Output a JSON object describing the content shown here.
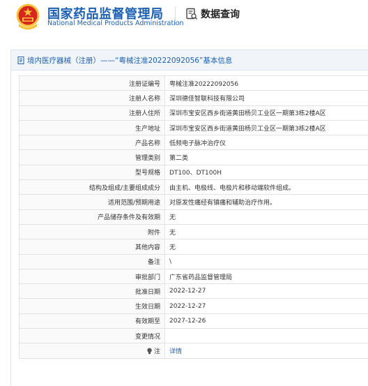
{
  "header": {
    "org_name_cn": "国家药品监督管理局",
    "org_name_en": "National Medical Products Administration",
    "query_label": "数据查询",
    "colors": {
      "brand": "#1a5fb4",
      "emblem_red": "#d7261e",
      "emblem_gold": "#f6c33a"
    }
  },
  "panel": {
    "title": "境内医疗器械（注册）——“粤械注准20222092056”基本信息"
  },
  "rows": [
    {
      "key": "注册证编号",
      "value": "粤械注准20222092056"
    },
    {
      "key": "注册人名称",
      "value": "深圳德佳智联科技有限公司"
    },
    {
      "key": "注册人住所",
      "value": "深圳市宝安区西乡街道黄田杨贝工业区一期第3栋2楼A区"
    },
    {
      "key": "生产地址",
      "value": "深圳市宝安区西乡街道黄田杨贝工业区一期第3栋2楼A区"
    },
    {
      "key": "产品名称",
      "value": "低频电子脉冲治疗仪"
    },
    {
      "key": "管理类别",
      "value": "第二类"
    },
    {
      "key": "型号规格",
      "value": "DT100、DT100H"
    },
    {
      "key": "结构及组成/主要组成成分",
      "value": "由主机、电极线、电极片和移动端软件组成。"
    },
    {
      "key": "适用范围/预期用途",
      "value": "对原发性痛经有镇痛和辅助治疗作用。"
    },
    {
      "key": "产品储存条件及有效期",
      "value": "无"
    },
    {
      "key": "附件",
      "value": "无"
    },
    {
      "key": "其他内容",
      "value": "无"
    },
    {
      "key": "备注",
      "value": "\\"
    },
    {
      "key": "审批部门",
      "value": "广东省药品监督管理局"
    },
    {
      "key": "批准日期",
      "value": "2022-12-27"
    },
    {
      "key": "生效日期",
      "value": "2022-12-27"
    },
    {
      "key": "有效期至",
      "value": "2027-12-26"
    },
    {
      "key": "变更情况",
      "value": ""
    },
    {
      "key": "注",
      "value": "详情"
    }
  ]
}
